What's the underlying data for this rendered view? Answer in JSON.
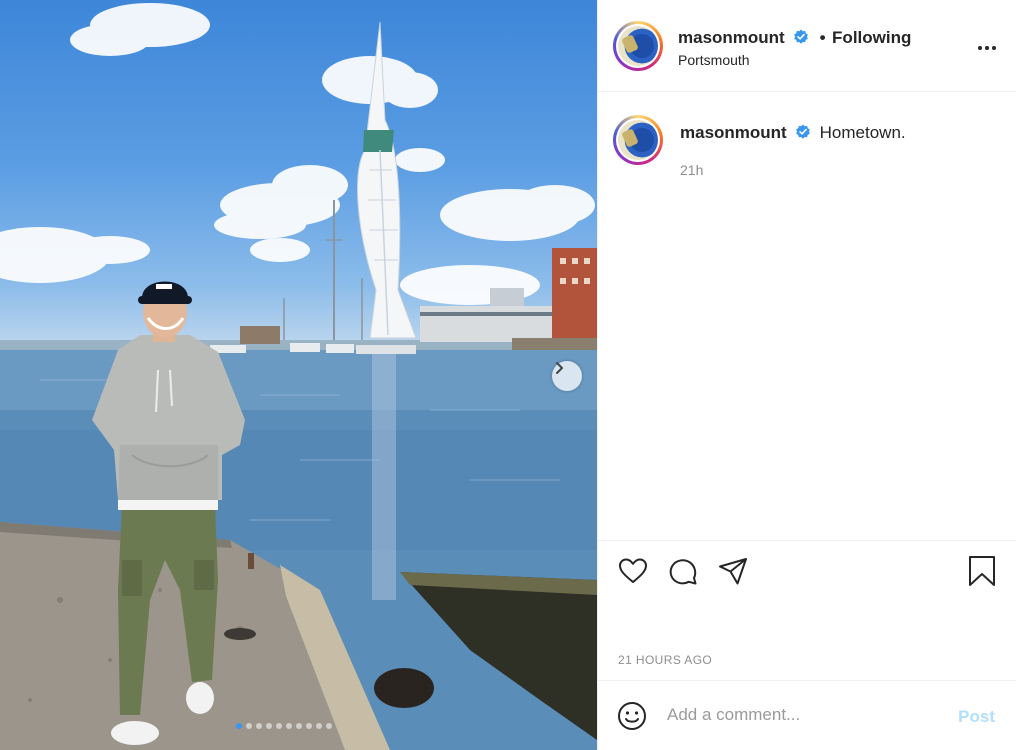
{
  "post": {
    "username": "masonmount",
    "follow_separator": "•",
    "follow_status": "Following",
    "location": "Portsmouth",
    "caption": "Hometown.",
    "caption_age": "21h",
    "posted_ago": "21 HOURS AGO"
  },
  "comment": {
    "placeholder": "Add a comment...",
    "post_label": "Post"
  },
  "carousel": {
    "slide_count": 10,
    "active_index": 0
  },
  "colors": {
    "verified_badge": "#3897f0",
    "post_button_disabled": "#b2dffc",
    "active_dot": "#3897f0"
  },
  "icons": {
    "verified": "verified-badge-icon",
    "more": "more-options-icon",
    "like": "heart-icon",
    "comment": "comment-bubble-icon",
    "share": "paper-plane-icon",
    "save": "bookmark-icon",
    "emoji": "emoji-smiley-icon",
    "next": "chevron-right-icon"
  }
}
